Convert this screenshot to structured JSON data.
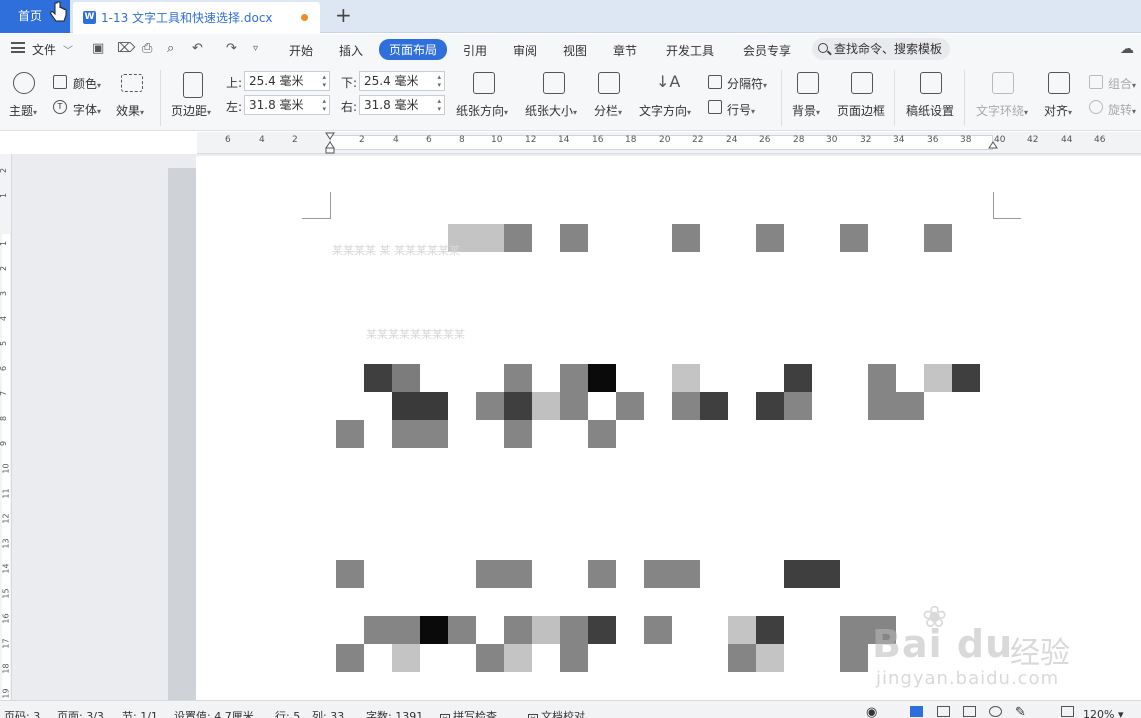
{
  "tabs": {
    "home": "首页",
    "document": "1-13 文字工具和快速选择.docx",
    "doc_icon": "W",
    "add": "+"
  },
  "menu": {
    "file": "文件",
    "tabs": [
      "开始",
      "插入",
      "页面布局",
      "引用",
      "审阅",
      "视图",
      "章节",
      "开发工具",
      "会员专享"
    ],
    "active_tab": "页面布局",
    "search_placeholder": "查找命令、搜索模板"
  },
  "ribbon": {
    "theme": "主题",
    "color": "颜色",
    "font": "字体",
    "effect": "效果",
    "margins": "页边距",
    "margin_top_label": "上:",
    "margin_top": "25.4 毫米",
    "margin_bottom_label": "下:",
    "margin_bottom": "25.4 毫米",
    "margin_left_label": "左:",
    "margin_left": "31.8 毫米",
    "margin_right_label": "右:",
    "margin_right": "31.8 毫米",
    "orientation": "纸张方向",
    "paper_size": "纸张大小",
    "columns": "分栏",
    "text_direction": "文字方向",
    "breaks": "分隔符",
    "line_numbers": "行号",
    "background": "背景",
    "page_border": "页面边框",
    "manuscript": "稿纸设置",
    "text_wrap": "文字环绕",
    "align": "对齐",
    "group": "组合",
    "rotate": "旋转"
  },
  "ruler": {
    "ticks": [
      "6",
      "4",
      "2",
      "2",
      "4",
      "6",
      "8",
      "10",
      "12",
      "14",
      "16",
      "18",
      "20",
      "22",
      "24",
      "26",
      "28",
      "30",
      "32",
      "34",
      "36",
      "38",
      "40",
      "42",
      "44",
      "46"
    ],
    "vticks": [
      "2",
      "1",
      "1",
      "2",
      "3",
      "4",
      "5",
      "6",
      "7",
      "8",
      "9",
      "10",
      "11",
      "12",
      "13",
      "14",
      "15",
      "16",
      "17",
      "18",
      "19"
    ]
  },
  "document": {
    "faint_line_1": "某某某某 某 某某某某某某",
    "faint_line_2": "某某某某某某某某某"
  },
  "watermark": {
    "brand": "Bai du",
    "jingyan": "经验",
    "site": "jingyan.baidu.com"
  },
  "status": {
    "page_num": "页码: 3",
    "pages": "页面: 3/3",
    "section": "节: 1/1",
    "position": "设置值: 4.7厘米",
    "row": "行: 5",
    "col": "列: 33",
    "words": "字数: 1391",
    "spell": "拼写检查",
    "proof": "文档校对",
    "zoom": "120%"
  },
  "colors": {
    "accent": "#2e6fdb",
    "tab_bg": "#dde6f3",
    "ribbon_bg": "#f6f7f9",
    "modified_dot": "#f08a24"
  }
}
